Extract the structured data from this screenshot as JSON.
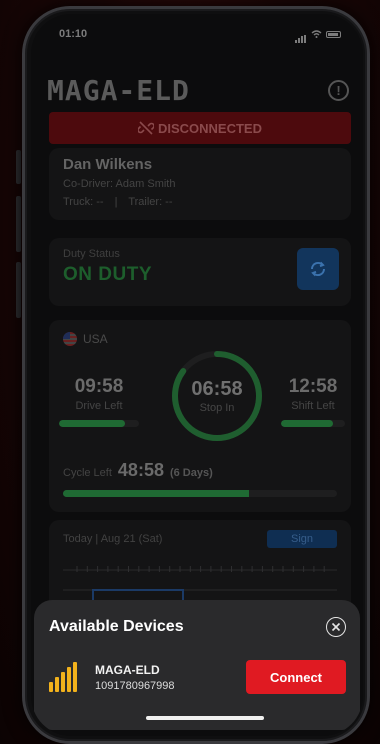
{
  "status_bar": {
    "time": "01:10"
  },
  "app": {
    "title": "MAGA-ELD",
    "connection_status": "DISCONNECTED"
  },
  "driver": {
    "name": "Dan Wilkens",
    "co_driver": "Co-Driver: Adam Smith",
    "truck": "Truck: --",
    "separator": "|",
    "trailer": "Trailer: --"
  },
  "duty": {
    "label": "Duty Status",
    "value": "ON DUTY"
  },
  "hos": {
    "country": "USA",
    "drive": {
      "value": "09:58",
      "label": "Drive Left",
      "progress": 0.82
    },
    "stop": {
      "value": "06:58",
      "label": "Stop In",
      "progress": 0.85
    },
    "shift": {
      "value": "12:58",
      "label": "Shift Left",
      "progress": 0.82
    },
    "cycle": {
      "label": "Cycle Left",
      "value": "48:58",
      "days": "(6 Days)",
      "progress": 0.68
    }
  },
  "log": {
    "date": "Today | Aug 21 (Sat)",
    "sign_label": "Sign"
  },
  "sheet": {
    "title": "Available Devices",
    "device": {
      "name": "MAGA-ELD",
      "id": "1091780967998"
    },
    "connect_label": "Connect"
  },
  "colors": {
    "brand_red": "#e01a22",
    "status_green": "#1f6a33",
    "signal_yellow": "#f2b21c",
    "sheet_bg": "#2a2a2c"
  }
}
